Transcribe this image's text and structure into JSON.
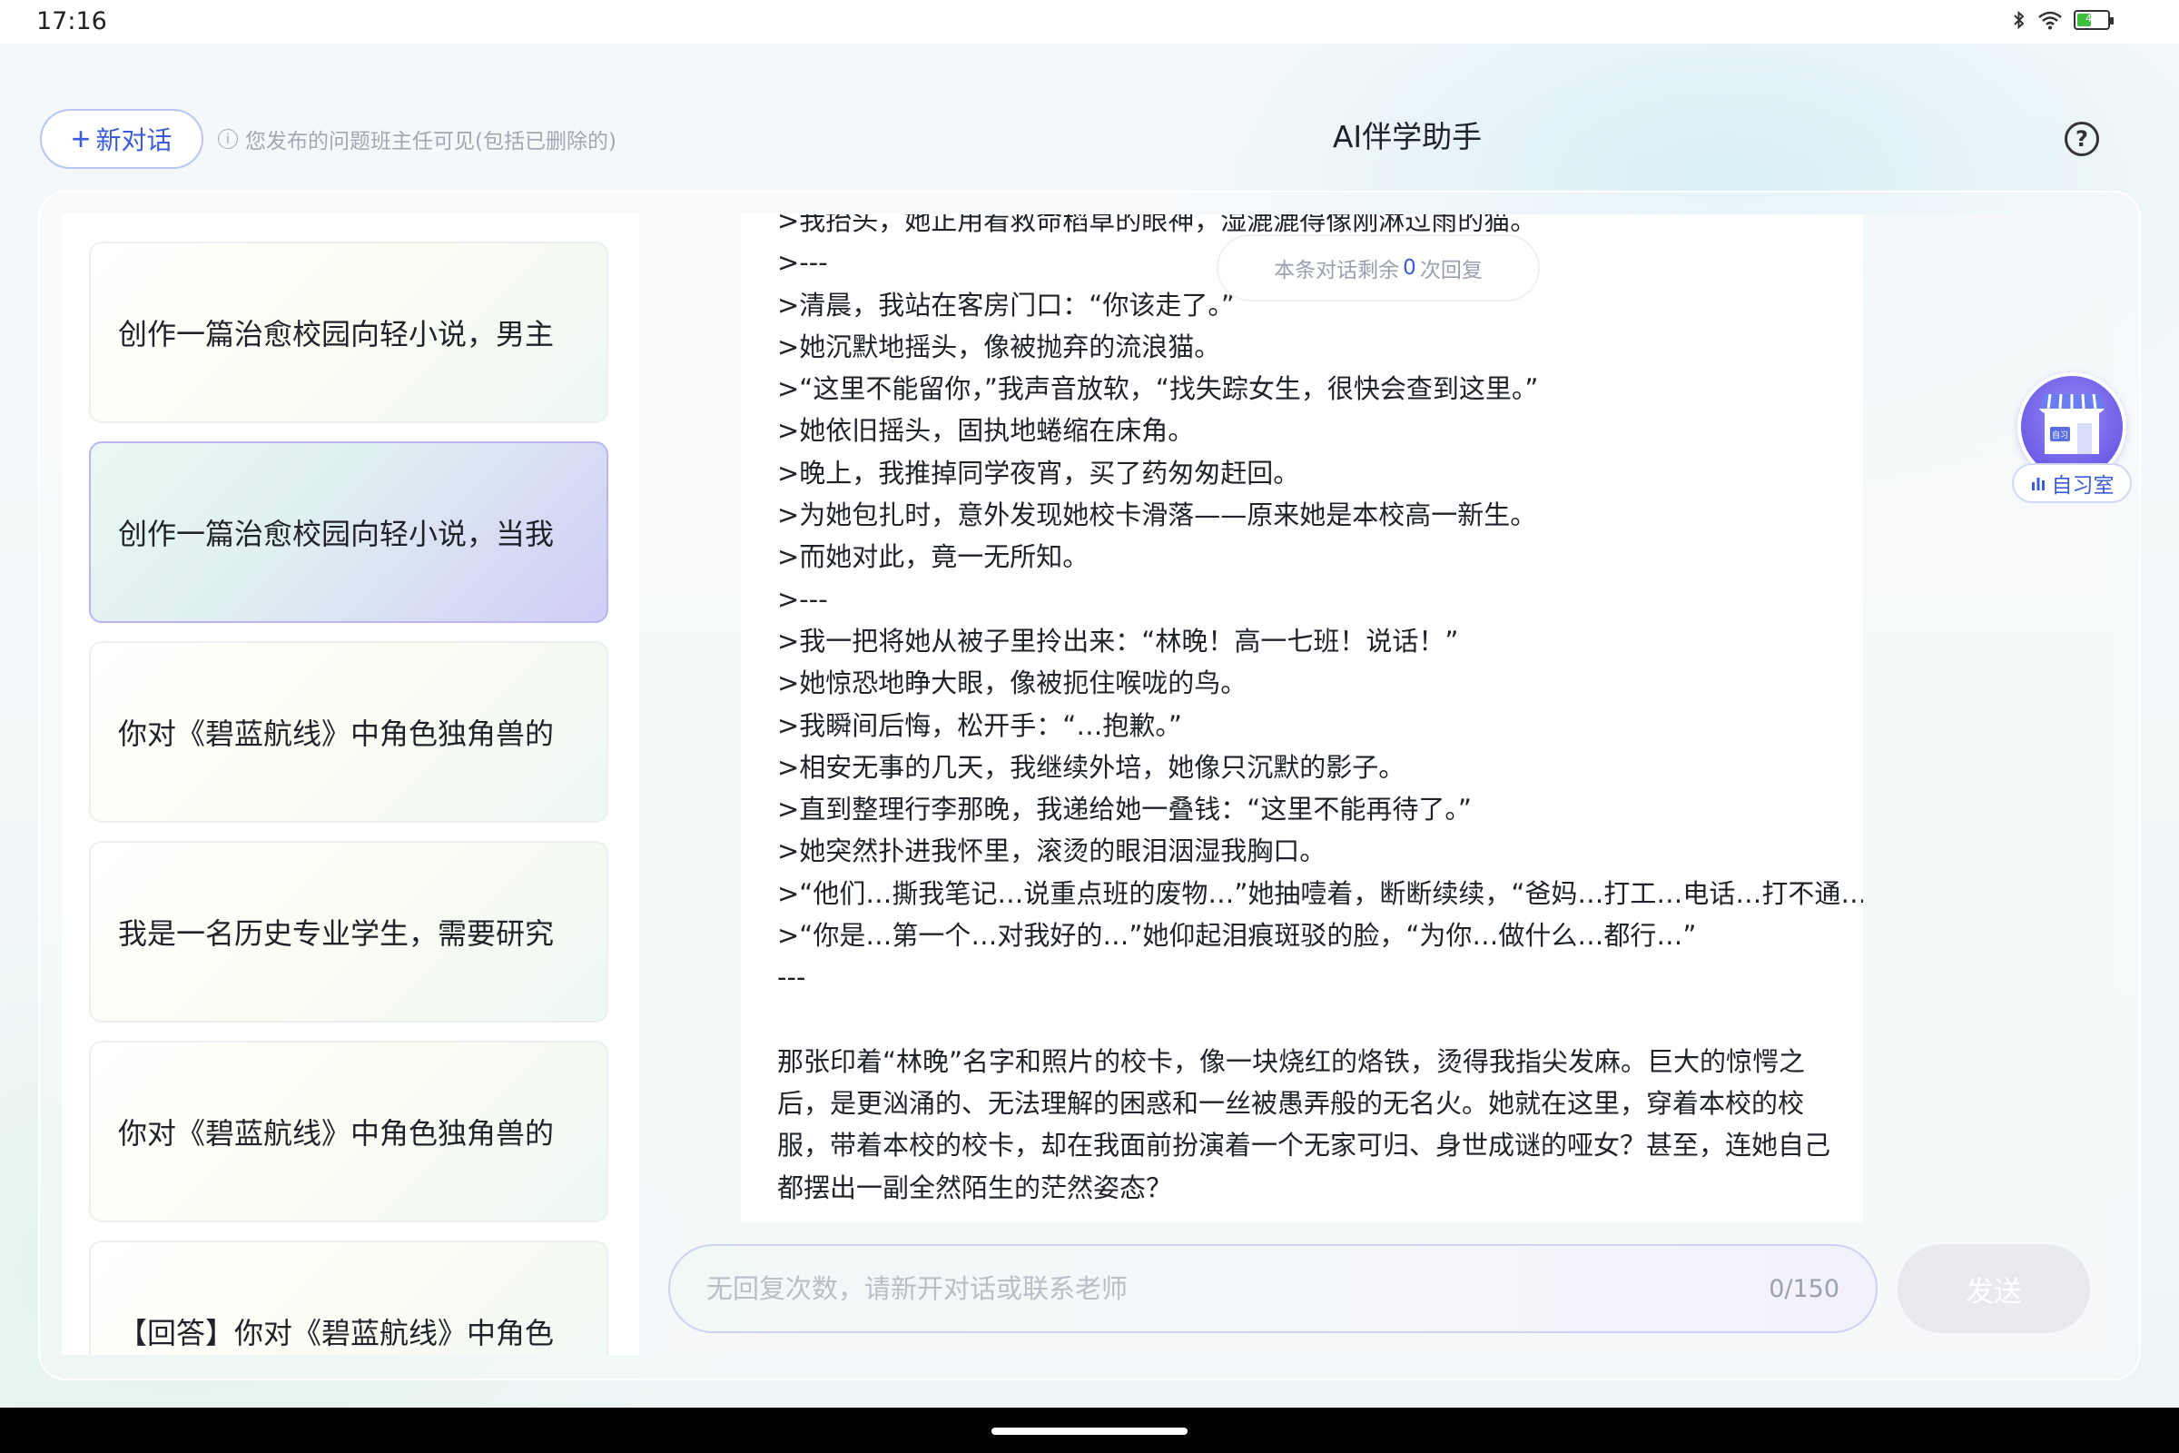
{
  "status_bar": {
    "time": "17:16",
    "battery_level": "46",
    "icons": [
      "bluetooth-icon",
      "wifi-icon",
      "battery-icon"
    ]
  },
  "header": {
    "new_chat_label": "新对话",
    "notice": "您发布的问题班主任可见(包括已删除的)",
    "title": "AI伴学助手",
    "help_symbol": "?"
  },
  "sidebar": {
    "items": [
      {
        "label": "创作一篇治愈校园向轻小说，男主",
        "active": false
      },
      {
        "label": "创作一篇治愈校园向轻小说，当我",
        "active": true
      },
      {
        "label": "你对《碧蓝航线》中角色独角兽的",
        "active": false
      },
      {
        "label": "我是一名历史专业学生，需要研究",
        "active": false
      },
      {
        "label": "你对《碧蓝航线》中角色独角兽的",
        "active": false
      },
      {
        "label": "【回答】你对《碧蓝航线》中角色",
        "active": false
      }
    ]
  },
  "chat": {
    "remaining": {
      "prefix": "本条对话剩余",
      "count": "0",
      "suffix": "次回复"
    },
    "message_lines": [
      ">我抬头，她正用看救命稻草的眼神，湿漉漉得像刚淋过雨的猫。",
      ">---",
      ">清晨，我站在客房门口：“你该走了。”",
      ">她沉默地摇头，像被抛弃的流浪猫。",
      ">“这里不能留你，”我声音放软，“找失踪女生，很快会查到这里。”",
      ">她依旧摇头，固执地蜷缩在床角。",
      ">晚上，我推掉同学夜宵，买了药匆匆赶回。",
      ">为她包扎时，意外发现她校卡滑落——原来她是本校高一新生。",
      ">而她对此，竟一无所知。",
      ">---",
      ">我一把将她从被子里拎出来：“林晚！高一七班！说话！”",
      ">她惊恐地睁大眼，像被扼住喉咙的鸟。",
      ">我瞬间后悔，松开手：“…抱歉。”",
      ">相安无事的几天，我继续外培，她像只沉默的影子。",
      ">直到整理行李那晚，我递给她一叠钱：“这里不能再待了。”",
      ">她突然扑进我怀里，滚烫的眼泪洇湿我胸口。",
      ">“他们…撕我笔记…说重点班的废物…”她抽噎着，断断续续，“爸妈…打工…电话…打不通…”",
      ">“你是…第一个…对我好的…”她仰起泪痕斑驳的脸，“为你…做什么…都行…”",
      "---"
    ],
    "paragraph": "那张印着“林晚”名字和照片的校卡，像一块烧红的烙铁，烫得我指尖发麻。巨大的惊愕之后，是更汹涌的、无法理解的困惑和一丝被愚弄般的无名火。她就在这里，穿着本校的校服，带着本校的校卡，却在我面前扮演着一个无家可归、身世成谜的哑女？甚至，连她自己都摆出一副全然陌生的茫然姿态？"
  },
  "study_room": {
    "label": "自习室",
    "sign_text": "自习"
  },
  "input": {
    "placeholder": "无回复次数，请新开对话或联系老师",
    "value": "",
    "char_count": "0/150",
    "send_label": "发送"
  }
}
